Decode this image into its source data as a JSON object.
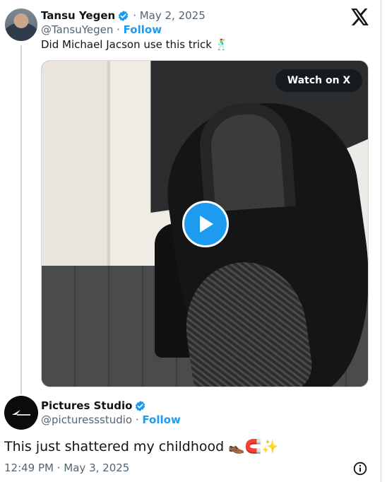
{
  "quoted_tweet": {
    "author_name": "Tansu Yegen",
    "date": "· May 2, 2025",
    "handle": "@TansuYegen",
    "follow_label": "Follow",
    "text": "Did Michael Jacson use this trick 🕺",
    "video": {
      "watch_label": "Watch on X"
    }
  },
  "main_tweet": {
    "author_name": "Pictures Studio",
    "handle": "@picturessstudio",
    "follow_label": "Follow",
    "text": "This just shattered my childhood 👞🧲✨",
    "timestamp": "12:49 PM · May 3, 2025"
  },
  "separator": " · ",
  "colors": {
    "accent": "#1d9bf0",
    "text": "#0f1419",
    "secondary": "#536471",
    "border": "#cfd9de"
  },
  "icons": {
    "verified": "verified-badge-icon",
    "x_logo": "x-logo-icon",
    "play": "play-icon",
    "info": "info-icon"
  }
}
